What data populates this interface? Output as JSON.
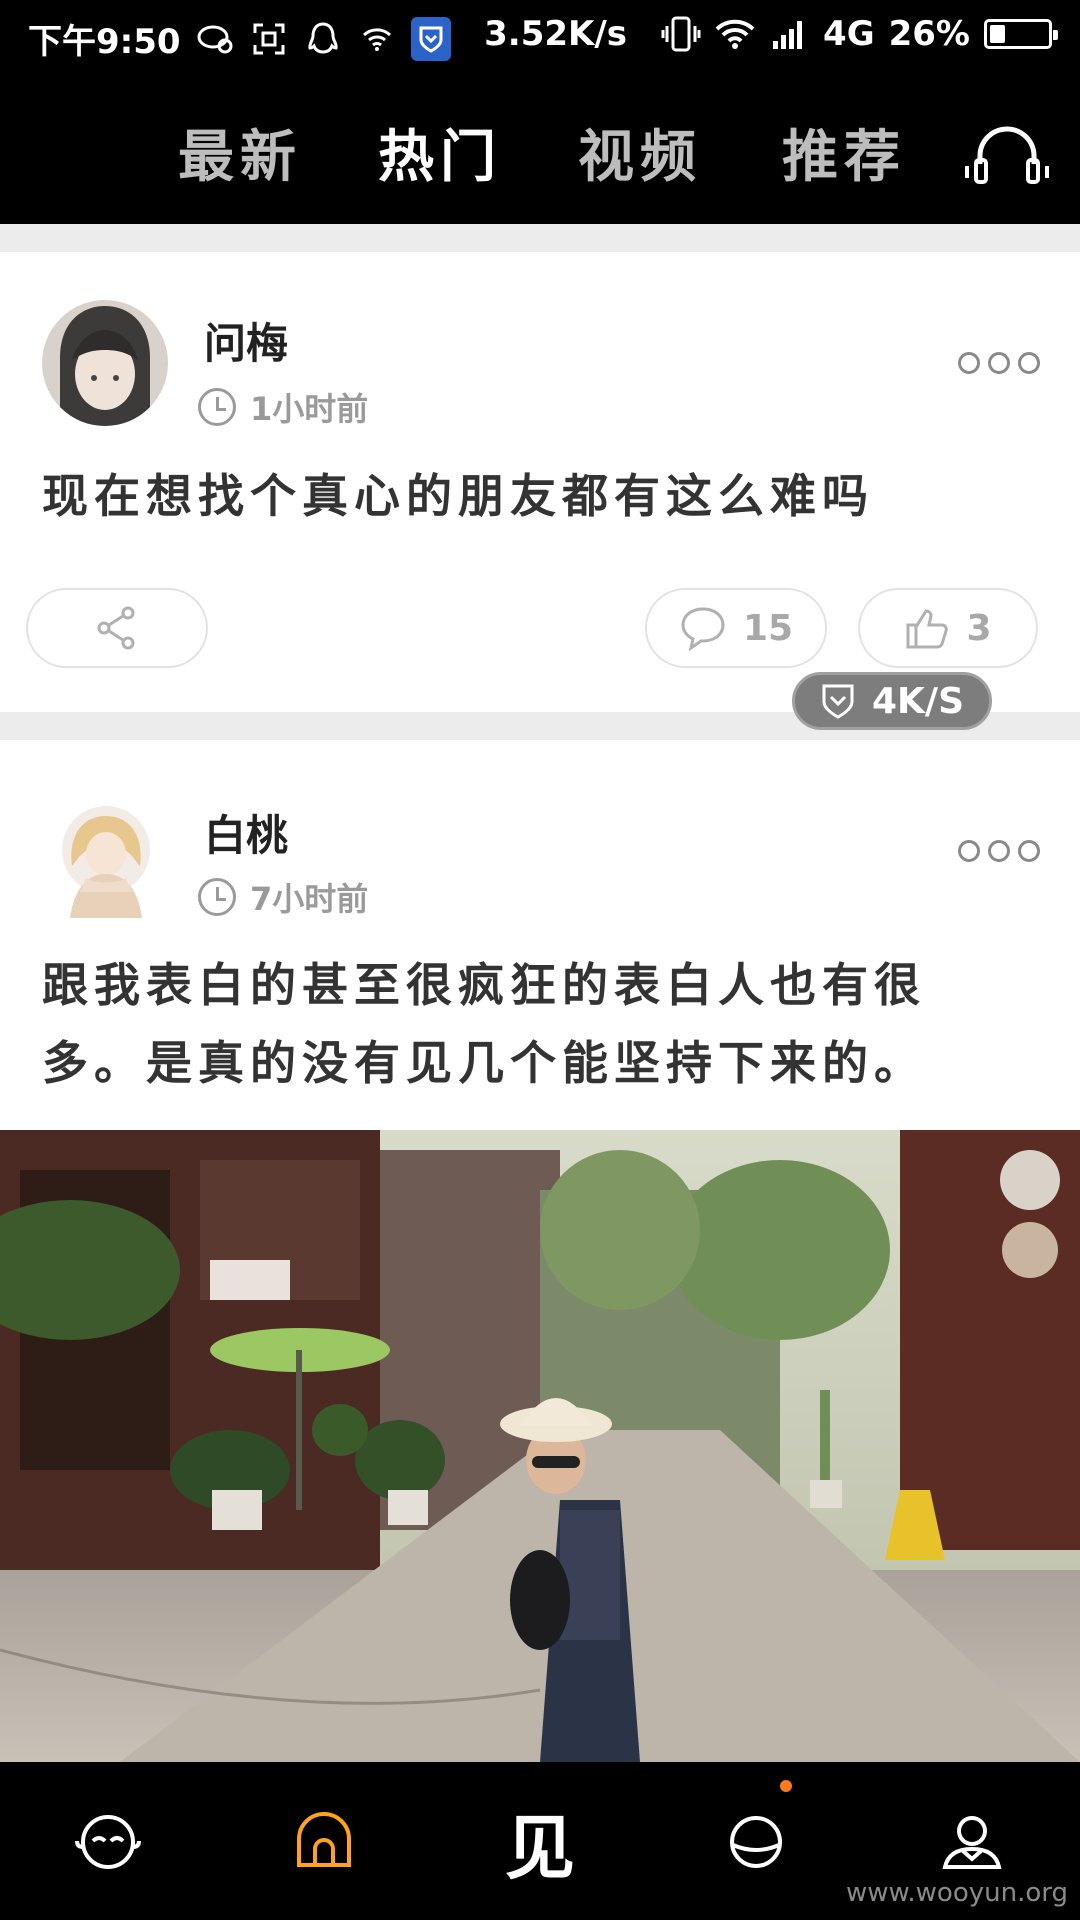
{
  "status_bar": {
    "time": "下午9:50",
    "speed": "3.52K/s",
    "network": "4G",
    "battery": "26%",
    "battery_level": 0.26
  },
  "top_nav": {
    "tabs": [
      {
        "label": "最新",
        "active": false
      },
      {
        "label": "热门",
        "active": true
      },
      {
        "label": "视频",
        "active": false
      },
      {
        "label": "推荐",
        "active": false
      }
    ],
    "icon": "headphones-icon"
  },
  "posts": [
    {
      "username": "问梅",
      "time": "1小时前",
      "text": "现在想找个真心的朋友都有这么难吗",
      "comments": "15",
      "likes": "3"
    },
    {
      "username": "白桃",
      "time": "7小时前",
      "text": "跟我表白的甚至很疯狂的表白人也有很多。是真的没有见几个能坚持下来的。"
    }
  ],
  "speed_badge": "4K/S",
  "bottom_nav": {
    "center_label": "见",
    "items": [
      "face-icon",
      "home-icon",
      "jian-tab",
      "planet-icon",
      "profile-icon"
    ]
  },
  "watermark": "www.wooyun.org",
  "colors": {
    "accent": "#ff9a1f",
    "bar": "#000000"
  }
}
